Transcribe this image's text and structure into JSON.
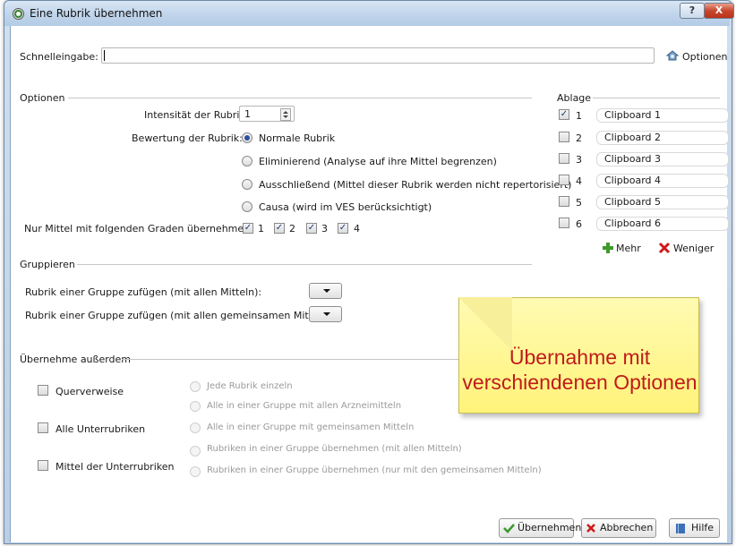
{
  "window": {
    "title": "Eine Rubrik übernehmen",
    "help": "?",
    "close": "X"
  },
  "quick": {
    "label": "Schnelleingabe:",
    "value": "",
    "options_label": "Optionen"
  },
  "options": {
    "section": "Optionen",
    "intensity_label": "Intensität der Rubrik:",
    "intensity_value": "1",
    "rating_label": "Bewertung der Rubrik:",
    "ratings": [
      {
        "label": "Normale Rubrik",
        "selected": true
      },
      {
        "label": "Eliminierend (Analyse auf ihre Mittel begrenzen)",
        "selected": false
      },
      {
        "label": "Ausschließend (Mittel dieser Rubrik werden nicht repertorisiert)",
        "selected": false
      },
      {
        "label": "Causa (wird im VES berücksichtigt)",
        "selected": false
      }
    ],
    "grades_label": "Nur Mittel mit folgenden Graden übernehmen:",
    "grades": [
      "1",
      "2",
      "3",
      "4"
    ]
  },
  "ablage": {
    "section": "Ablage",
    "items": [
      {
        "num": "1",
        "name": "Clipboard 1",
        "checked": true
      },
      {
        "num": "2",
        "name": "Clipboard 2",
        "checked": false
      },
      {
        "num": "3",
        "name": "Clipboard 3",
        "checked": false
      },
      {
        "num": "4",
        "name": "Clipboard 4",
        "checked": false
      },
      {
        "num": "5",
        "name": "Clipboard 5",
        "checked": false
      },
      {
        "num": "6",
        "name": "Clipboard 6",
        "checked": false
      }
    ],
    "more": "Mehr",
    "less": "Weniger"
  },
  "group": {
    "section": "Gruppieren",
    "all": "Rubrik einer Gruppe zufügen (mit allen Mitteln):",
    "common": "Rubrik einer Gruppe zufügen (mit allen gemeinsamen Mitteln):"
  },
  "also": {
    "section": "Übernehme außerdem",
    "checks": [
      "Querverweise",
      "Alle Unterrubriken",
      "Mittel der Unterrubriken"
    ],
    "radios": [
      "Jede Rubrik einzeln",
      "Alle in einer Gruppe mit allen Arzneimitteln",
      "Alle in einer Gruppe mit gemeinsamen Mitteln",
      "Rubriken in einer Gruppe übernehmen (mit allen Mitteln)",
      "Rubriken in einer Gruppe übernehmen (nur mit den gemeinsamen Mitteln)"
    ]
  },
  "note": {
    "text": "Übernahme mit verschiendenen Optionen"
  },
  "buttons": {
    "ok": "Übernehmen",
    "cancel": "Abbrechen",
    "help": "Hilfe"
  },
  "colors": {
    "accent": "#2a4fa0",
    "note_bg": "#fff37a",
    "note_text": "#c01b1b"
  }
}
